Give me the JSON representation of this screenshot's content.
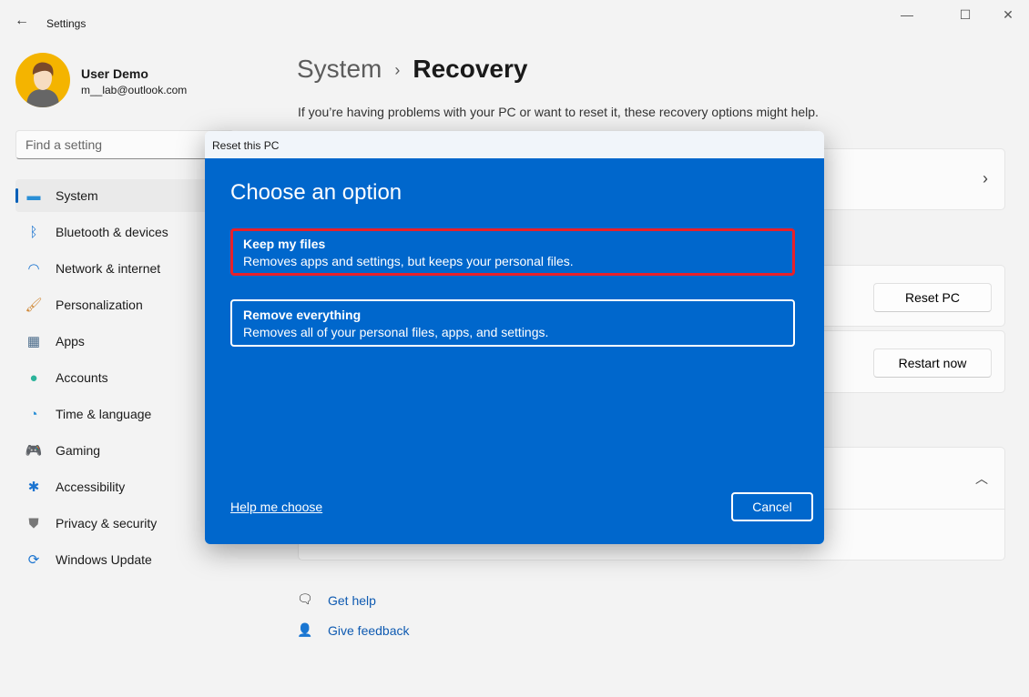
{
  "window": {
    "title": "Settings",
    "back_icon": "arrow-left-icon",
    "controls": [
      "minimize-icon",
      "maximize-icon",
      "close-icon"
    ]
  },
  "user": {
    "name": "User Demo",
    "email": "m__lab@outlook.com"
  },
  "search": {
    "placeholder": "Find a setting"
  },
  "sidebar": {
    "items": [
      {
        "label": "System",
        "icon": "monitor-icon",
        "active": true
      },
      {
        "label": "Bluetooth & devices",
        "icon": "bluetooth-icon"
      },
      {
        "label": "Network & internet",
        "icon": "wifi-icon"
      },
      {
        "label": "Personalization",
        "icon": "brush-icon"
      },
      {
        "label": "Apps",
        "icon": "apps-icon"
      },
      {
        "label": "Accounts",
        "icon": "person-icon"
      },
      {
        "label": "Time & language",
        "icon": "globe-clock-icon"
      },
      {
        "label": "Gaming",
        "icon": "gamepad-icon"
      },
      {
        "label": "Accessibility",
        "icon": "accessibility-icon"
      },
      {
        "label": "Privacy & security",
        "icon": "shield-icon"
      },
      {
        "label": "Windows Update",
        "icon": "update-icon"
      }
    ]
  },
  "main": {
    "breadcrumb_parent": "System",
    "breadcrumb_sep": "›",
    "title": "Recovery",
    "description": "If you’re having problems with your PC or want to reset it, these recovery options might help.",
    "reset_button": "Reset PC",
    "restart_button": "Restart now",
    "get_help": "Get help",
    "give_feedback": "Give feedback"
  },
  "dialog": {
    "title": "Reset this PC",
    "heading": "Choose an option",
    "options": [
      {
        "title": "Keep my files",
        "desc": "Removes apps and settings, but keeps your personal files.",
        "highlighted": true
      },
      {
        "title": "Remove everything",
        "desc": "Removes all of your personal files, apps, and settings."
      }
    ],
    "help_link": "Help me choose",
    "cancel": "Cancel"
  },
  "colors": {
    "accent": "#005fb8",
    "dialog_bg": "#0067cc",
    "highlight": "#e8202a"
  }
}
